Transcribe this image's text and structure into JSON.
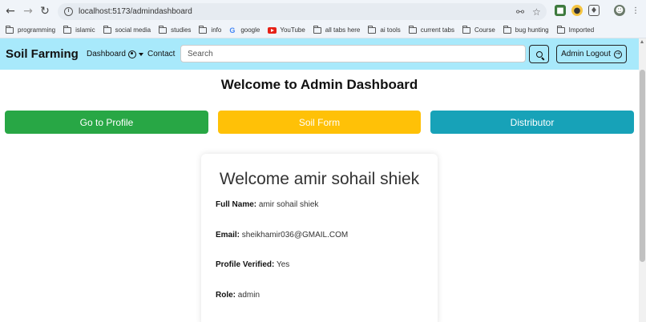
{
  "browser": {
    "url": "localhost:5173/admindashboard",
    "bookmarks": [
      {
        "label": "programming",
        "icon": "folder-icon"
      },
      {
        "label": "islamic",
        "icon": "folder-icon"
      },
      {
        "label": "social media",
        "icon": "folder-icon"
      },
      {
        "label": "studies",
        "icon": "folder-icon"
      },
      {
        "label": "info",
        "icon": "folder-icon"
      },
      {
        "label": "google",
        "icon": "google-icon"
      },
      {
        "label": "YouTube",
        "icon": "youtube-icon"
      },
      {
        "label": "all tabs here",
        "icon": "folder-icon"
      },
      {
        "label": "ai tools",
        "icon": "folder-icon"
      },
      {
        "label": "current tabs",
        "icon": "folder-icon"
      },
      {
        "label": "Course",
        "icon": "folder-icon"
      },
      {
        "label": "bug hunting",
        "icon": "folder-icon"
      },
      {
        "label": "Imported",
        "icon": "folder-icon"
      }
    ]
  },
  "navbar": {
    "brand": "Soil Farming",
    "dashboard_label": "Dashboard",
    "contact_label": "Contact",
    "search_placeholder": "Search",
    "logout_label": "Admin Logout"
  },
  "main": {
    "title": "Welcome to Admin Dashboard",
    "buttons": [
      {
        "label": "Go to Profile",
        "color": "#28a745"
      },
      {
        "label": "Soil Form",
        "color": "#ffc107"
      },
      {
        "label": "Distributor",
        "color": "#17a2b8"
      }
    ]
  },
  "profile": {
    "greeting": "Welcome amir sohail shiek",
    "fields": [
      {
        "label": "Full Name:",
        "value": "amir sohail shiek"
      },
      {
        "label": "Email:",
        "value": "sheikhamir036@GMAIL.COM"
      },
      {
        "label": "Profile Verified:",
        "value": "Yes"
      },
      {
        "label": "Role:",
        "value": "admin"
      }
    ]
  },
  "colors": {
    "navbar_bg": "#a8e9fb",
    "chrome_bg": "#f0f4f9"
  }
}
